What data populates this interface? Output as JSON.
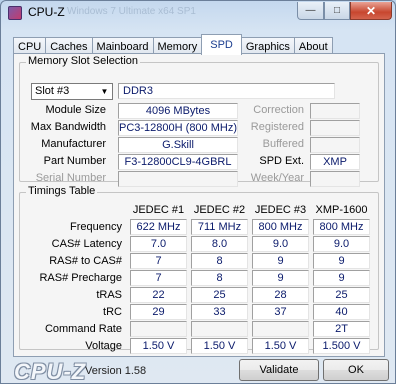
{
  "window": {
    "title": "CPU-Z",
    "background_title": "Windows 7 Ultimate x64 SP1",
    "controls": {
      "minimize": "—",
      "maximize": "□",
      "close": "✕"
    }
  },
  "tabs": [
    "CPU",
    "Caches",
    "Mainboard",
    "Memory",
    "SPD",
    "Graphics",
    "About"
  ],
  "active_tab": "SPD",
  "memory_slot": {
    "group_title": "Memory Slot Selection",
    "slot_selected": "Slot #3",
    "type": "DDR3",
    "labels": {
      "module_size": "Module Size",
      "max_bandwidth": "Max Bandwidth",
      "manufacturer": "Manufacturer",
      "part_number": "Part Number",
      "serial_number": "Serial Number",
      "correction": "Correction",
      "registered": "Registered",
      "buffered": "Buffered",
      "spd_ext": "SPD Ext.",
      "week_year": "Week/Year"
    },
    "values": {
      "module_size": "4096 MBytes",
      "max_bandwidth": "PC3-12800H (800 MHz)",
      "manufacturer": "G.Skill",
      "part_number": "F3-12800CL9-4GBRL",
      "serial_number": "",
      "correction": "",
      "registered": "",
      "buffered": "",
      "spd_ext": "XMP",
      "week_year": ""
    }
  },
  "timings": {
    "group_title": "Timings Table",
    "columns": [
      "JEDEC #1",
      "JEDEC #2",
      "JEDEC #3",
      "XMP-1600"
    ],
    "rows": [
      {
        "label": "Frequency",
        "values": [
          "622 MHz",
          "711 MHz",
          "800 MHz",
          "800 MHz"
        ]
      },
      {
        "label": "CAS# Latency",
        "values": [
          "7.0",
          "8.0",
          "9.0",
          "9.0"
        ]
      },
      {
        "label": "RAS# to CAS#",
        "values": [
          "7",
          "8",
          "9",
          "9"
        ]
      },
      {
        "label": "RAS# Precharge",
        "values": [
          "7",
          "8",
          "9",
          "9"
        ]
      },
      {
        "label": "tRAS",
        "values": [
          "22",
          "25",
          "28",
          "25"
        ]
      },
      {
        "label": "tRC",
        "values": [
          "29",
          "33",
          "37",
          "40"
        ]
      },
      {
        "label": "Command Rate",
        "values": [
          "",
          "",
          "",
          "2T"
        ]
      },
      {
        "label": "Voltage",
        "values": [
          "1.50 V",
          "1.50 V",
          "1.50 V",
          "1.500 V"
        ]
      }
    ]
  },
  "footer": {
    "brand": "CPU-Z",
    "version": "Version 1.58",
    "validate_label": "Validate",
    "ok_label": "OK"
  }
}
